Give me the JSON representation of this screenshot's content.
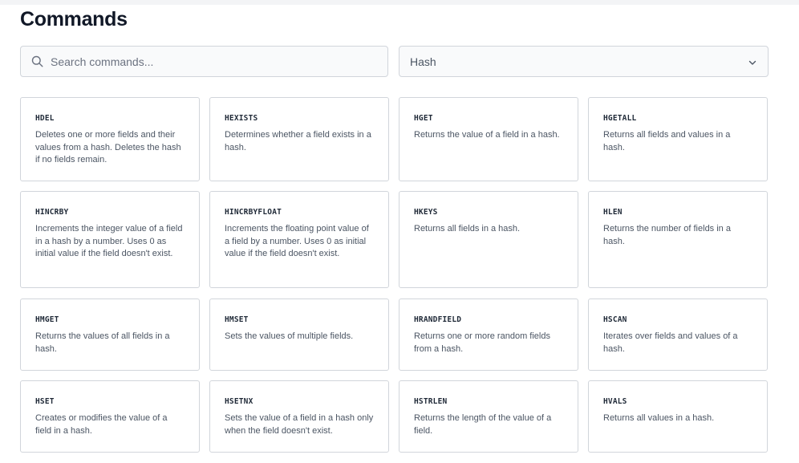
{
  "page": {
    "title": "Commands"
  },
  "search": {
    "placeholder": "Search commands...",
    "value": ""
  },
  "category_select": {
    "selected": "Hash"
  },
  "commands": [
    {
      "name": "HDEL",
      "description": "Deletes one or more fields and their values from a hash. Deletes the hash if no fields remain."
    },
    {
      "name": "HEXISTS",
      "description": "Determines whether a field exists in a hash."
    },
    {
      "name": "HGET",
      "description": "Returns the value of a field in a hash."
    },
    {
      "name": "HGETALL",
      "description": "Returns all fields and values in a hash."
    },
    {
      "name": "HINCRBY",
      "description": "Increments the integer value of a field in a hash by a number. Uses 0 as initial value if the field doesn't exist."
    },
    {
      "name": "HINCRBYFLOAT",
      "description": "Increments the floating point value of a field by a number. Uses 0 as initial value if the field doesn't exist."
    },
    {
      "name": "HKEYS",
      "description": "Returns all fields in a hash."
    },
    {
      "name": "HLEN",
      "description": "Returns the number of fields in a hash."
    },
    {
      "name": "HMGET",
      "description": "Returns the values of all fields in a hash."
    },
    {
      "name": "HMSET",
      "description": "Sets the values of multiple fields."
    },
    {
      "name": "HRANDFIELD",
      "description": "Returns one or more random fields from a hash."
    },
    {
      "name": "HSCAN",
      "description": "Iterates over fields and values of a hash."
    },
    {
      "name": "HSET",
      "description": "Creates or modifies the value of a field in a hash."
    },
    {
      "name": "HSETNX",
      "description": "Sets the value of a field in a hash only when the field doesn't exist."
    },
    {
      "name": "HSTRLEN",
      "description": "Returns the length of the value of a field."
    },
    {
      "name": "HVALS",
      "description": "Returns all values in a hash."
    }
  ],
  "icons": {
    "search": "search-icon",
    "select_chevron": "chevron-down-icon"
  },
  "colors": {
    "title": "#111827",
    "border": "#d1d5db",
    "field_bg": "#f9fafb",
    "description": "#4b5563"
  }
}
